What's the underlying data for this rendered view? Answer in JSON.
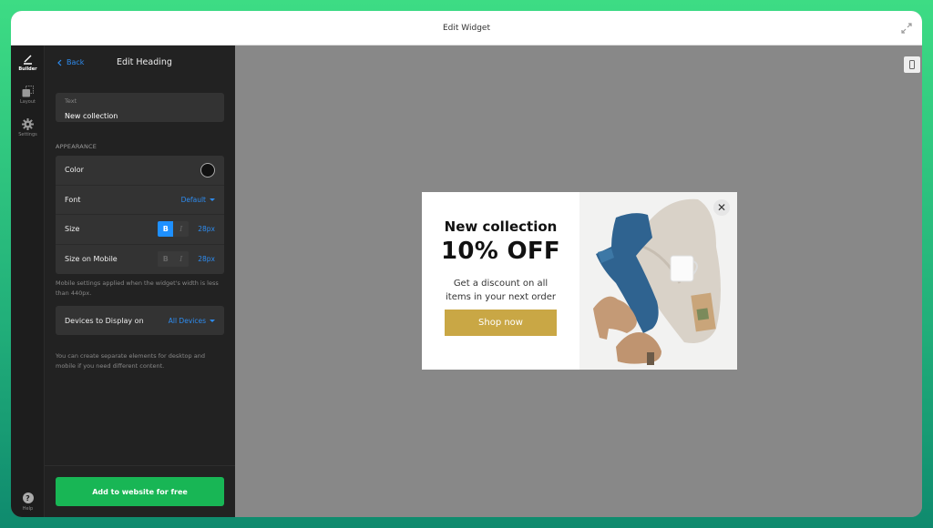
{
  "window": {
    "title": "Edit Widget"
  },
  "rail": {
    "items": [
      {
        "label": "Builder",
        "icon": "pencil-icon",
        "active": true
      },
      {
        "label": "Layout",
        "icon": "layers-icon"
      },
      {
        "label": "Settings",
        "icon": "gear-icon"
      }
    ],
    "help_label": "Help",
    "help_glyph": "?"
  },
  "panel": {
    "back_label": "Back",
    "title": "Edit Heading",
    "text_field": {
      "label": "Text",
      "value": "New collection"
    },
    "appearance_label": "APPEARANCE",
    "rows": {
      "color": {
        "label": "Color",
        "value": "#111111"
      },
      "font": {
        "label": "Font",
        "value": "Default"
      },
      "size": {
        "label": "Size",
        "bold": "B",
        "italic": "I",
        "value": "28px"
      },
      "size_mobile": {
        "label": "Size on Mobile",
        "bold": "B",
        "italic": "I",
        "value": "28px"
      }
    },
    "mobile_hint": "Mobile settings applied when the widget's width is less than 440px.",
    "devices": {
      "label": "Devices to Display on",
      "value": "All Devices"
    },
    "devices_hint": "You can create separate elements for desktop and mobile if you need different content.",
    "cta_label": "Add to website for free"
  },
  "popup": {
    "heading": "New collection",
    "offer": "10% OFF",
    "description": "Get a discount on all items in your next order",
    "button_label": "Shop now",
    "close_glyph": "✕",
    "image_alt": "Flat lay of jeans, knit sweater, mug, tea and suede ankle boots"
  },
  "colors": {
    "accent": "#2e8cf0",
    "cta": "#18b655",
    "shop_button": "#c9a745"
  }
}
